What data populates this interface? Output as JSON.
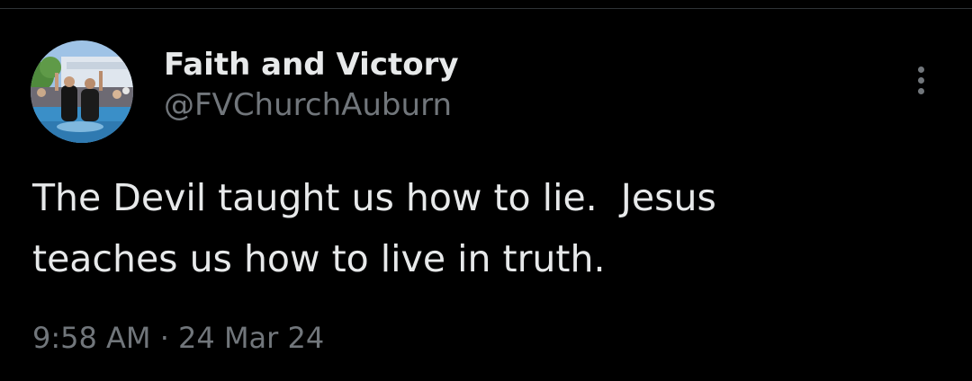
{
  "tweet": {
    "author": {
      "display_name": "Faith and Victory",
      "handle": "@FVChurchAuburn",
      "avatar_icon": "profile-photo"
    },
    "text_line_1": "The Devil taught us how to lie.  Jesus",
    "text_line_2": "teaches us how to live in truth.",
    "time": "9:58 AM",
    "separator": "·",
    "date": "24 Mar 24"
  },
  "actions": {
    "more_icon": "more-options-icon"
  },
  "colors": {
    "background": "#000000",
    "primary_text": "#e7e9ea",
    "secondary_text": "#71767b",
    "divider": "#2f3336"
  }
}
